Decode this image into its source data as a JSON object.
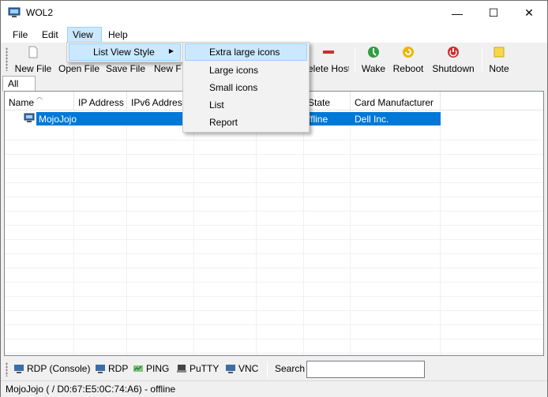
{
  "window": {
    "title": "WOL2",
    "controls": {
      "minimize": "—",
      "maximize": "☐",
      "close": "✕"
    }
  },
  "menubar": {
    "items": [
      "File",
      "Edit",
      "View",
      "Help"
    ],
    "open_item": "View"
  },
  "toolbar": {
    "buttons": [
      {
        "label": "New File",
        "icon": "new-file-icon"
      },
      {
        "label": "Open File",
        "icon": "open-file-icon"
      },
      {
        "label": "Save File",
        "icon": "save-file-icon"
      },
      {
        "label": "New F",
        "icon": "new-folder-icon"
      },
      {
        "label": "elete Host",
        "icon": "delete-host-icon"
      },
      {
        "label": "Wake",
        "icon": "wake-icon"
      },
      {
        "label": "Reboot",
        "icon": "reboot-icon"
      },
      {
        "label": "Shutdown",
        "icon": "shutdown-icon"
      },
      {
        "label": "Note",
        "icon": "note-icon"
      }
    ]
  },
  "tabs": {
    "active": "All"
  },
  "listview": {
    "columns": [
      "Name",
      "IP Address",
      "IPv6 Address",
      "",
      "",
      "State",
      "Card Manufacturer"
    ],
    "rows": [
      {
        "name": "MojoJojo",
        "ip": "",
        "ipv6": "",
        "state": "ffline",
        "manufacturer": "Dell Inc."
      }
    ]
  },
  "view_menu": {
    "items": [
      {
        "label": "List View Style",
        "has_submenu": true
      }
    ]
  },
  "list_view_style_submenu": {
    "items": [
      "Extra large icons",
      "Large icons",
      "Small icons",
      "List",
      "Report"
    ],
    "highlighted": "Extra large icons"
  },
  "bottom_toolbar": {
    "buttons": [
      {
        "label": "RDP (Console)",
        "icon": "rdp-console-icon"
      },
      {
        "label": "RDP",
        "icon": "rdp-icon"
      },
      {
        "label": "PING",
        "icon": "ping-icon"
      },
      {
        "label": "PuTTY",
        "icon": "putty-icon"
      },
      {
        "label": "VNC",
        "icon": "vnc-icon"
      }
    ],
    "search_label": "Search",
    "search_value": ""
  },
  "statusbar": {
    "text": "MojoJojo ( / D0:67:E5:0C:74:A6) - offline"
  },
  "colors": {
    "selection": "#0078d7",
    "menu_highlight": "#cce8ff"
  }
}
